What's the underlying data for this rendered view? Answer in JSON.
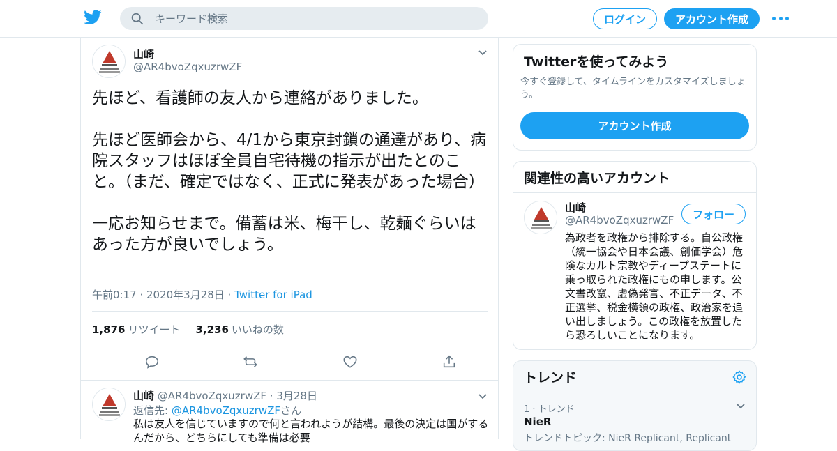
{
  "colors": {
    "brand": "#1da1f2",
    "link": "#1b95e0",
    "muted": "#657786",
    "text": "#14171a",
    "border": "#e1e8ed"
  },
  "header": {
    "logo_icon": "twitter-bird-icon",
    "search_placeholder": "キーワード検索",
    "login_label": "ログイン",
    "signup_label": "アカウント作成",
    "more_icon": "more-dots-icon"
  },
  "tweet": {
    "author_name": "山崎",
    "author_handle": "@AR4bvoZqxuzrwZF",
    "text": "先ほど、看護師の友人から連絡がありました。\n\n先ほど医師会から、4/1から東京封鎖の通達があり、病院スタッフはほぼ全員自宅待機の指示が出たとのこと。（まだ、確定ではなく、正式に発表があった場合）\n\n一応お知らせまで。備蓄は米、梅干し、乾麺ぐらいはあった方が良いでしょう。",
    "time": "午前0:17 · 2020年3月28日 · ",
    "client": "Twitter for iPad",
    "retweets_count": "1,876",
    "retweets_label": "リツイート",
    "likes_count": "3,236",
    "likes_label": "いいねの数"
  },
  "reply": {
    "author_name": "山崎",
    "author_handle": "@AR4bvoZqxuzrwZF",
    "date": "· 3月28日",
    "reply_to_label": "返信先: ",
    "reply_to_handle": "@AR4bvoZqxuzrwZF",
    "reply_to_suffix": "さん",
    "text": "私は友人を信じていますので何と言われようが結構。最後の決定は国がするんだから、どちらにしても準備は必要"
  },
  "sidebar": {
    "signup_card": {
      "title": "Twitterを使ってみよう",
      "description": "今すぐ登録して、タイムラインをカスタマイズしましょう。",
      "button": "アカウント作成"
    },
    "related_card": {
      "title": "関連性の高いアカウント",
      "name": "山崎",
      "handle": "@AR4bvoZqxuzrwZF",
      "follow_label": "フォロー",
      "bio": "為政者を政権から排除する。自公政権（統一協会や日本会議、創価学会）危険なカルト宗教やディープステートに乗っ取られた政権にもの申します。公文書改竄、虚偽発言、不正データ、不正選挙、税金横領の政権、政治家を追い出しましょう。この政権を放置したら恐ろしいことになります。"
    },
    "trends_card": {
      "title": "トレンド",
      "rank": "1 · トレンド",
      "name": "NieR",
      "topics": "トレンドトピック: NieR Replicant, Replicant"
    }
  }
}
